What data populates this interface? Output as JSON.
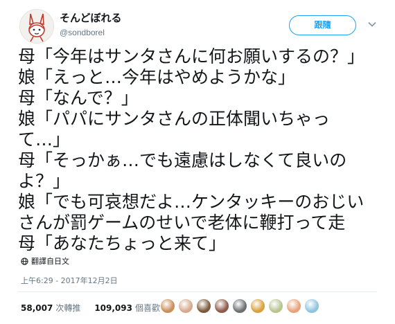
{
  "user": {
    "display_name": "そんどぼれる",
    "handle": "@sondborel",
    "avatar_icon": "drawn-rabbit-girl-avatar"
  },
  "follow_button": {
    "label": "跟隨"
  },
  "more_icon": "chevron-down-icon",
  "tweet": {
    "lines": [
      "母「今年はサンタさんに何お願いするの？」",
      "娘「えっと…今年はやめようかな」",
      "母「なんで？」",
      "娘「パパにサンタさんの正体聞いちゃっ",
      "て…」",
      "母「そっかぁ…でも遠慮はしなくて良いの",
      "よ？」",
      "娘「でも可哀想だよ…ケンタッキーのおじい",
      "さんが罰ゲームのせいで老体に鞭打って走",
      "母「あなたちょっと来て」"
    ]
  },
  "translate": {
    "label": "翻譯自日文",
    "icon": "globe-icon"
  },
  "timestamp": "上午6:29 - 2017年12月2日",
  "stats": {
    "retweets_count": "58,007",
    "retweets_label": "次轉推",
    "likes_count": "109,093",
    "likes_label": "個喜歡"
  },
  "likers": {
    "colors": [
      "#c98e5a",
      "#d7a98c",
      "#7b5a3c",
      "#8c5b4a",
      "#6e6f73",
      "#d9a03c",
      "#b7c48e",
      "#e8a27a",
      "#8fc4e0"
    ]
  },
  "colors": {
    "accent": "#1da1f2",
    "text": "#14171a",
    "muted": "#657786"
  }
}
